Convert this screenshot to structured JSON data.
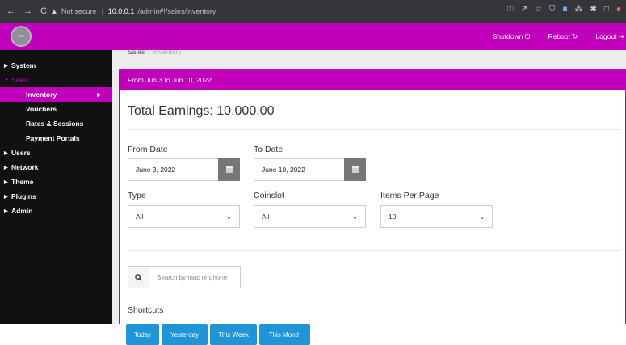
{
  "browser": {
    "security_label": "Not secure",
    "host": "10.0.0.1",
    "path": "/admin#!/sales/inventory"
  },
  "topbar": {
    "shutdown_label": "Shutdown",
    "reboot_label": "Reboot",
    "logout_label": "Logout"
  },
  "sidebar": {
    "items": [
      {
        "label": "System"
      },
      {
        "label": "Sales"
      },
      {
        "label": "Users"
      },
      {
        "label": "Network"
      },
      {
        "label": "Theme"
      },
      {
        "label": "Plugins"
      },
      {
        "label": "Admin"
      }
    ],
    "sales_sub": [
      {
        "label": "Inventory"
      },
      {
        "label": "Vouchers"
      },
      {
        "label": "Rates & Sessions"
      },
      {
        "label": "Payment Portals"
      }
    ]
  },
  "breadcrumb": {
    "first": "Sales",
    "second": "Inventory"
  },
  "panel": {
    "header": "From Jun 3 to Jun 10, 2022",
    "total_earnings": "Total Earnings: 10,000.00"
  },
  "filters": {
    "from_label": "From Date",
    "from_value": "June 3, 2022",
    "to_label": "To Date",
    "to_value": "June 10, 2022",
    "type_label": "Type",
    "type_value": "All",
    "coinslot_label": "Coinslot",
    "coinslot_value": "All",
    "items_label": "Items Per Page",
    "items_value": "10",
    "search_placeholder": "Search by mac or phone"
  },
  "shortcuts": {
    "title": "Shortcuts",
    "buttons": [
      "Today",
      "Yesterday",
      "This Week",
      "This Month"
    ]
  },
  "colors": {
    "accent": "#c000bb",
    "button": "#1f95d8",
    "sidebar": "#111111"
  }
}
